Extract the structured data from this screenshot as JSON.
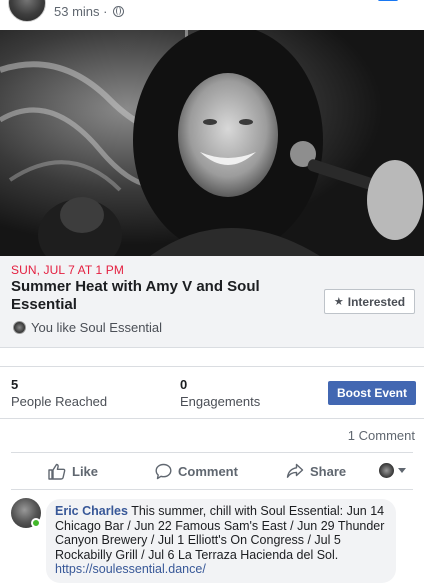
{
  "post": {
    "time": "53 mins · "
  },
  "event": {
    "date": "SUN, JUL 7 AT 1 PM",
    "title": "Summer Heat with Amy V and Soul Essential",
    "interested_label": "Interested",
    "like_info": "You like Soul Essential"
  },
  "stats": {
    "people_reached_value": "5",
    "people_reached_label": "People Reached",
    "engagements_value": "0",
    "engagements_label": "Engagements",
    "boost_label": "Boost Event"
  },
  "comments_count": "1 Comment",
  "actions": {
    "like": "Like",
    "comment": "Comment",
    "share": "Share"
  },
  "comment": {
    "author": "Eric Charles",
    "text": "This summer, chill with Soul Essential: Jun 14 Chicago Bar / Jun 22 Famous Sam's East / Jun 29 Thunder Canyon Brewery / Jul 1 Elliott's On Congress / Jul 5 Rockabilly Grill / Jul 6 La Terraza Hacienda del Sol.",
    "link": "https://soulessential.dance/"
  },
  "colors": {
    "date_red": "#e41e3f",
    "boost_blue": "#4267b2",
    "link_blue": "#385898",
    "online_green": "#42b72a"
  },
  "icons": {
    "privacy": "globe-icon",
    "interested": "star-icon",
    "like": "thumbs-up-icon",
    "comment": "speech-bubble-icon",
    "share": "share-arrow-icon",
    "reaction_menu": "caret-down-icon"
  }
}
